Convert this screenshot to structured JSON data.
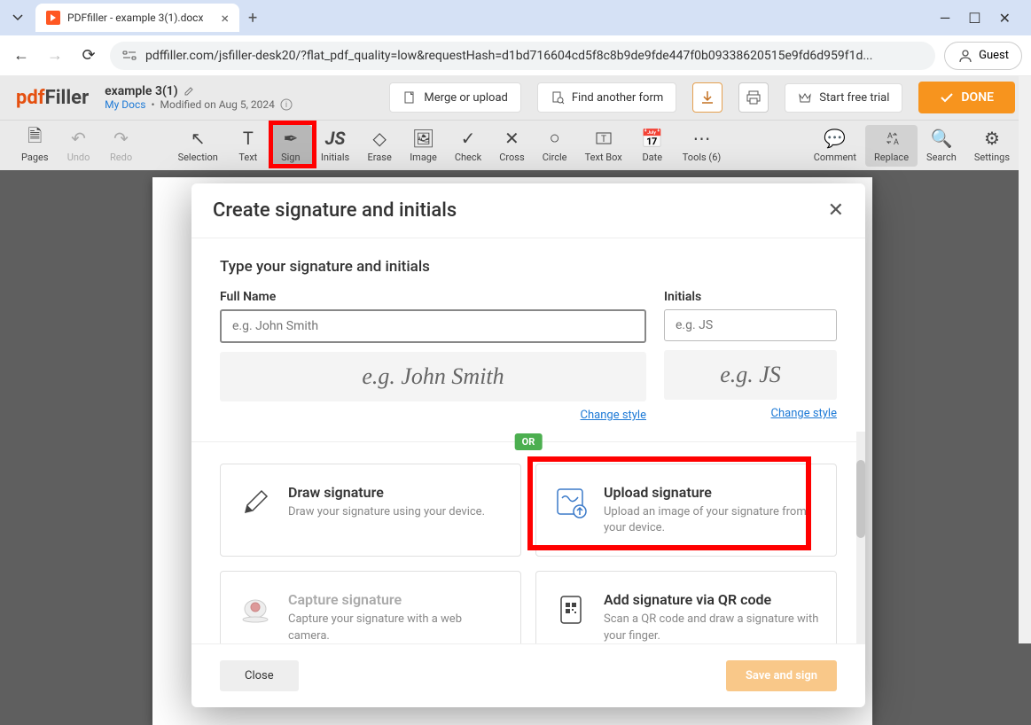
{
  "browser": {
    "tab_title": "PDFfiller - example 3(1).docx",
    "url": "pdffiller.com/jsfiller-desk20/?flat_pdf_quality=low&requestHash=d1bd716604cd5f8c8b9de9fde447f0b09338620515e9fd6d959f1d...",
    "guest": "Guest"
  },
  "header": {
    "logo_left": "pdf",
    "logo_right": "Filler",
    "doc_title": "example 3(1)",
    "my_docs": "My Docs",
    "modified": "Modified on Aug 5, 2024",
    "merge": "Merge or upload",
    "find": "Find another form",
    "trial": "Start free trial",
    "done": "DONE"
  },
  "toolbar": {
    "pages": "Pages",
    "undo": "Undo",
    "redo": "Redo",
    "selection": "Selection",
    "text": "Text",
    "sign": "Sign",
    "initials": "Initials",
    "erase": "Erase",
    "image": "Image",
    "check": "Check",
    "cross": "Cross",
    "circle": "Circle",
    "textbox": "Text Box",
    "date": "Date",
    "tools": "Tools (6)",
    "comment": "Comment",
    "replace": "Replace",
    "search": "Search",
    "settings": "Settings"
  },
  "modal": {
    "title": "Create signature and initials",
    "section_title": "Type your signature and initials",
    "fullname_label": "Full Name",
    "fullname_placeholder": "e.g. John Smith",
    "initials_label": "Initials",
    "initials_placeholder": "e.g. JS",
    "preview_fullname": "e.g. John Smith",
    "preview_initials": "e.g. JS",
    "change_style": "Change style",
    "or": "OR",
    "draw_title": "Draw signature",
    "draw_desc": "Draw your signature using your device.",
    "upload_title": "Upload signature",
    "upload_desc": "Upload an image of your signature from your device.",
    "capture_title": "Capture signature",
    "capture_desc": "Capture your signature with a web camera.",
    "qr_title": "Add signature via QR code",
    "qr_desc": "Scan a QR code and draw a signature with your finger.",
    "close": "Close",
    "save": "Save and sign"
  }
}
